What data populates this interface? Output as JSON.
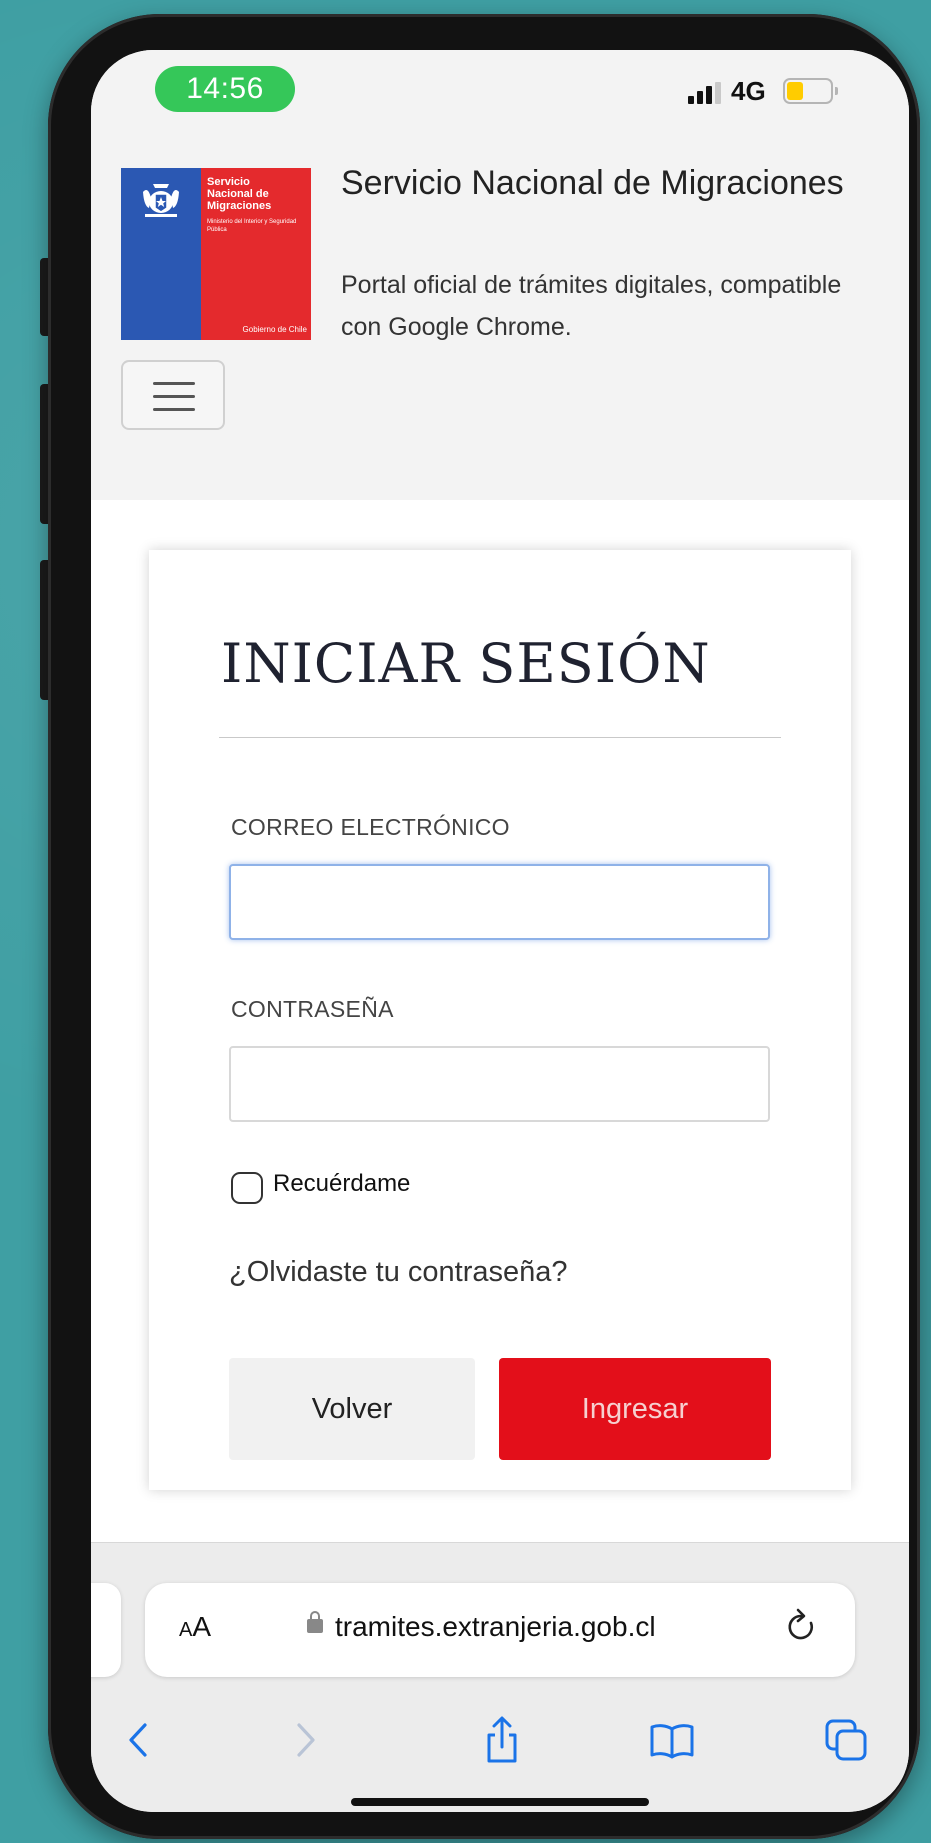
{
  "status_bar": {
    "time": "14:56",
    "network": "4G"
  },
  "header": {
    "logo_lines": [
      "Servicio",
      "Nacional de",
      "Migraciones"
    ],
    "logo_ministry": "Ministerio del Interior y Seguridad Pública",
    "logo_government": "Gobierno de Chile",
    "title": "Servicio Nacional de Migraciones",
    "subtitle": "Portal oficial de trámites digitales, compatible con Google Chrome."
  },
  "login": {
    "title": "INICIAR SESIÓN",
    "email_label": "CORREO ELECTRÓNICO",
    "email_value": "",
    "password_label": "CONTRASEÑA",
    "password_value": "",
    "remember_label": "Recuérdame",
    "remember_checked": false,
    "forgot_link": "¿Olvidaste tu contraseña?",
    "back_button": "Volver",
    "submit_button": "Ingresar"
  },
  "browser": {
    "text_size_button_small": "A",
    "text_size_button_large": "A",
    "url": "tramites.extranjeria.gob.cl",
    "toolbar_icons": [
      "back-icon",
      "forward-icon",
      "share-icon",
      "bookmarks-icon",
      "tabs-icon"
    ]
  },
  "colors": {
    "background": "#3f9fa3",
    "status_green": "#35c759",
    "brand_red": "#e42a2d",
    "brand_blue": "#2b58b3",
    "submit_red": "#e30f1a",
    "ios_blue": "#1a73e8"
  }
}
